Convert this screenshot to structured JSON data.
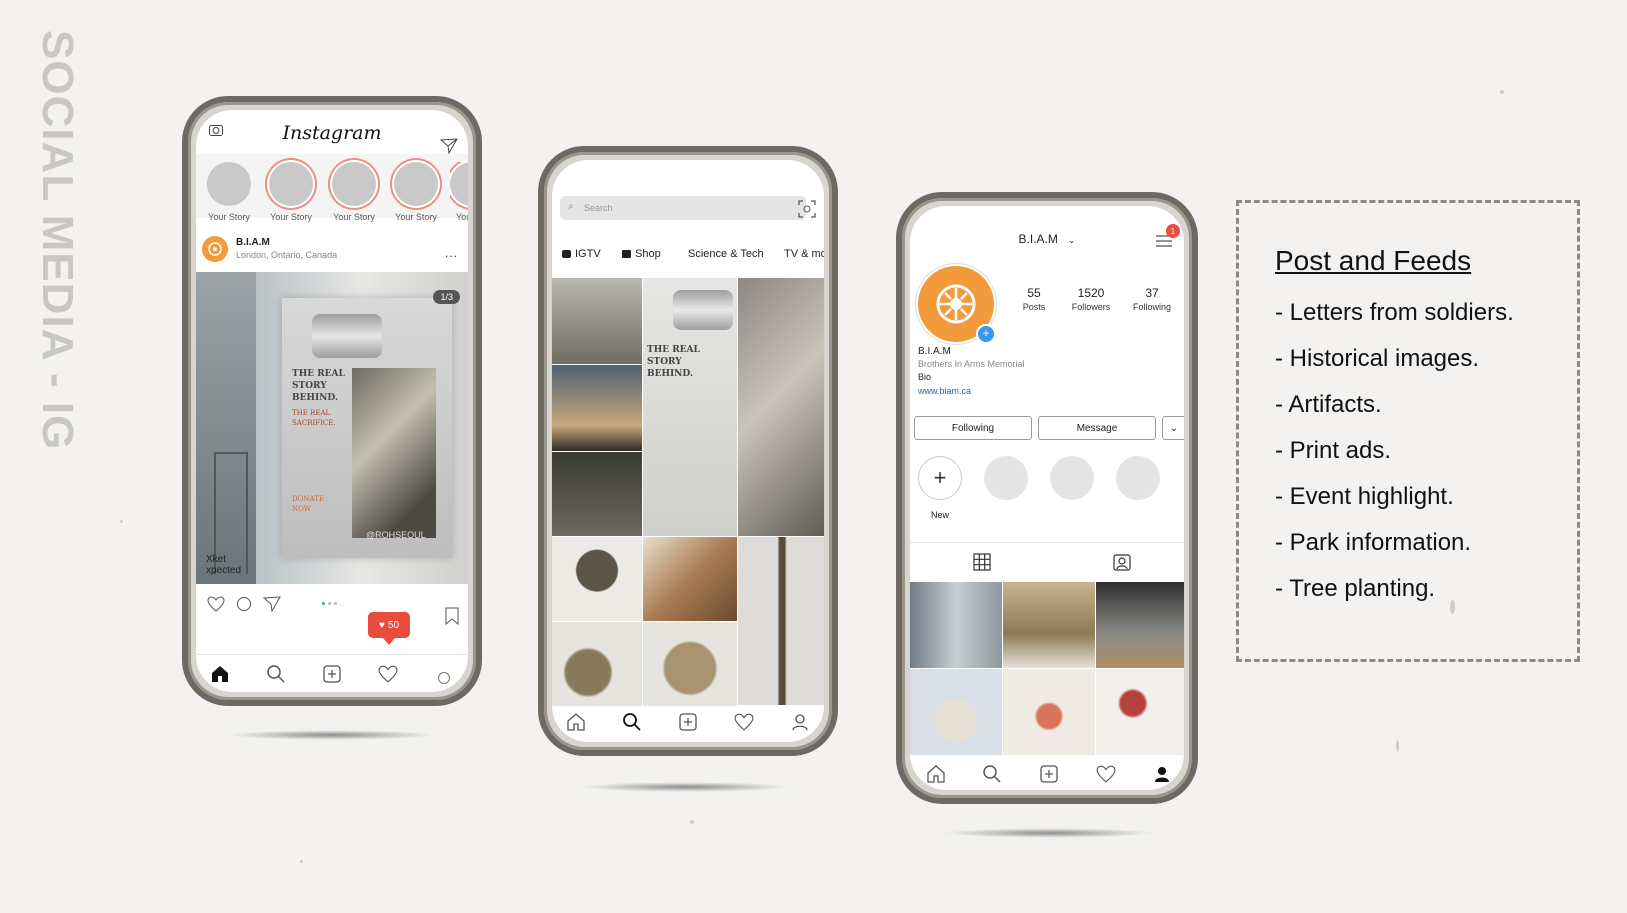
{
  "slide": {
    "title": "SOCIAL MEDIA - IG"
  },
  "phone1": {
    "app_title": "Instagram",
    "stories": [
      "Your Story",
      "Your Story",
      "Your Story",
      "Your Story",
      "Your"
    ],
    "post_user": "B.I.A.M",
    "post_location": "London, Ontario, Canada",
    "counter": "1/3",
    "poster_headline": "THE REAL STORY BEHIND.",
    "poster_sub": "THE REAL SACRIFICE.",
    "poster_cta": "DONATE NOW",
    "watermark": "@ROHSEOUL",
    "sign_text": "Xket xpected",
    "likes_badge": "50",
    "more": "..."
  },
  "phone2": {
    "search_placeholder": "Search",
    "categories": [
      "IGTV",
      "Shop",
      "Science & Tech",
      "TV & mo"
    ]
  },
  "phone3": {
    "username": "B.I.A.M",
    "notification_count": "1",
    "stats": [
      {
        "value": "55",
        "label": "Posts"
      },
      {
        "value": "1520",
        "label": "Followers"
      },
      {
        "value": "37",
        "label": "Following"
      }
    ],
    "name": "B.I.A.M",
    "subtitle": "Brothers In Arms Memorial",
    "bio": "Bio",
    "link": "www.biam.ca",
    "following_btn": "Following",
    "message_btn": "Message",
    "new_label": "New"
  },
  "notes": {
    "heading": "Post and Feeds",
    "items": [
      "- Letters from soldiers.",
      "- Historical images.",
      "- Artifacts.",
      "- Print ads.",
      "- Event highlight.",
      "- Park information.",
      "- Tree planting."
    ]
  },
  "colors": {
    "accent_orange": "#f39a3a",
    "like_red": "#e74c3c",
    "link_blue": "#2a5db0"
  }
}
